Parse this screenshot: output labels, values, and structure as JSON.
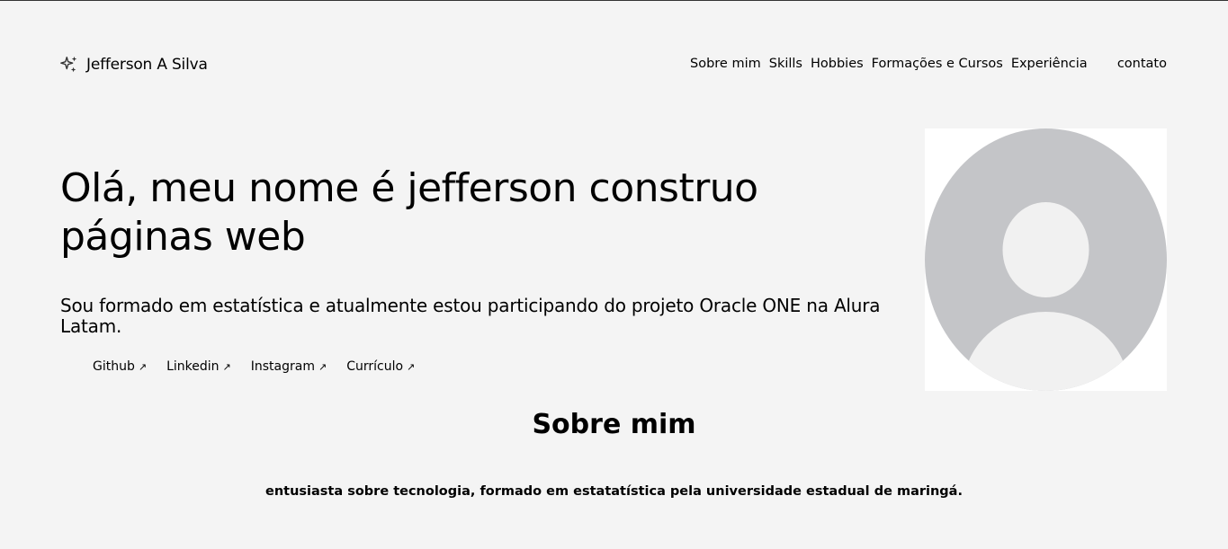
{
  "header": {
    "brand_name": "Jefferson A Silva",
    "brand_icon": "sparkles-icon",
    "nav": [
      {
        "label": "Sobre mim"
      },
      {
        "label": "Skills"
      },
      {
        "label": "Hobbies"
      },
      {
        "label": "Formações e Cursos"
      },
      {
        "label": "Experiência"
      }
    ],
    "contact_label": "contato"
  },
  "hero": {
    "title": "Olá, meu nome é jefferson construo páginas web",
    "subtitle": "Sou formado em estatística e atualmente estou participando do projeto Oracle ONE na Alura Latam.",
    "links": [
      {
        "label": "Github",
        "icon": "external-arrow-icon"
      },
      {
        "label": "Linkedin",
        "icon": "external-arrow-icon"
      },
      {
        "label": "Instagram",
        "icon": "external-arrow-icon"
      },
      {
        "label": "Currículo",
        "icon": "external-arrow-icon"
      }
    ],
    "avatar_icon": "user-avatar-placeholder"
  },
  "about": {
    "title": "Sobre mim",
    "text": "entusiasta sobre tecnologia, formado em estatatística pela universidade estadual de maringá."
  },
  "colors": {
    "background": "#f4f4f4",
    "avatar_bg": "#c4c5c8",
    "avatar_fg": "#f1f1f1"
  }
}
